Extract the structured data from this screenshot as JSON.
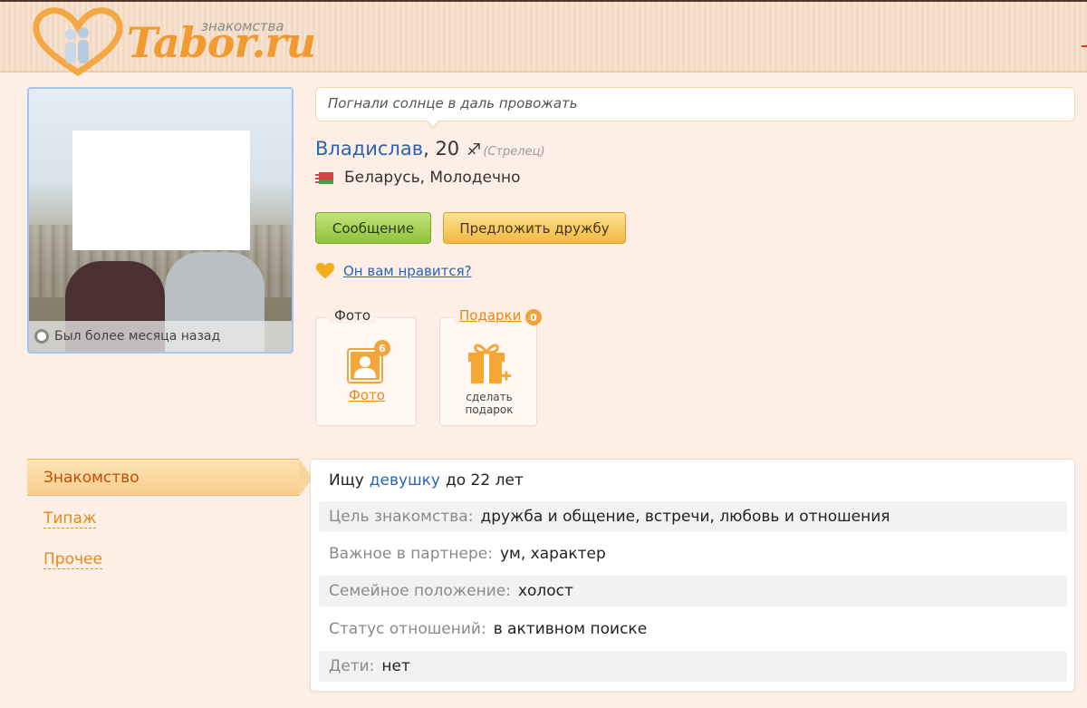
{
  "header": {
    "logo_sub": "знакомства",
    "logo_text": "Tabor.ru"
  },
  "photo": {
    "status_text": "Был более месяца назад"
  },
  "profile": {
    "status_message": "Погнали солнце в даль провожать",
    "name": "Владислав",
    "age": ", 20",
    "zodiac_icon": "sagittarius-icon",
    "zodiac_glyph": "♐",
    "zodiac_text": "(Стрелец)",
    "location": "Беларусь, Молодечно"
  },
  "actions": {
    "message_label": "Сообщение",
    "friend_label": "Предложить дружбу",
    "like_question": "Он вам нравится?"
  },
  "boxes": {
    "photo_title": "Фото",
    "photo_count": "6",
    "photo_link": "Фото",
    "gifts_title": "Подарки",
    "gifts_count": "0",
    "gift_line1": "сделать",
    "gift_line2": "подарок"
  },
  "menu": {
    "active": "Знакомство",
    "items": [
      "Типаж",
      "Прочее"
    ]
  },
  "details": {
    "seek_prefix": "Ищу",
    "seek_target": "девушку",
    "seek_suffix": "до 22 лет",
    "rows": [
      {
        "label": "Цель знакомства:",
        "value": "дружба и общение, встречи, любовь и отношения"
      },
      {
        "label": "Важное в партнере:",
        "value": "ум, характер"
      },
      {
        "label": "Семейное положение:",
        "value": "холост"
      },
      {
        "label": "Статус отношений:",
        "value": "в активном поиске"
      },
      {
        "label": "Дети:",
        "value": "нет"
      }
    ]
  },
  "colors": {
    "background": "#fdeee6",
    "link_blue": "#2a64b4",
    "accent_orange": "#e48a1c",
    "green_button": "#8fc23b",
    "yellow_button": "#f2b83e"
  }
}
